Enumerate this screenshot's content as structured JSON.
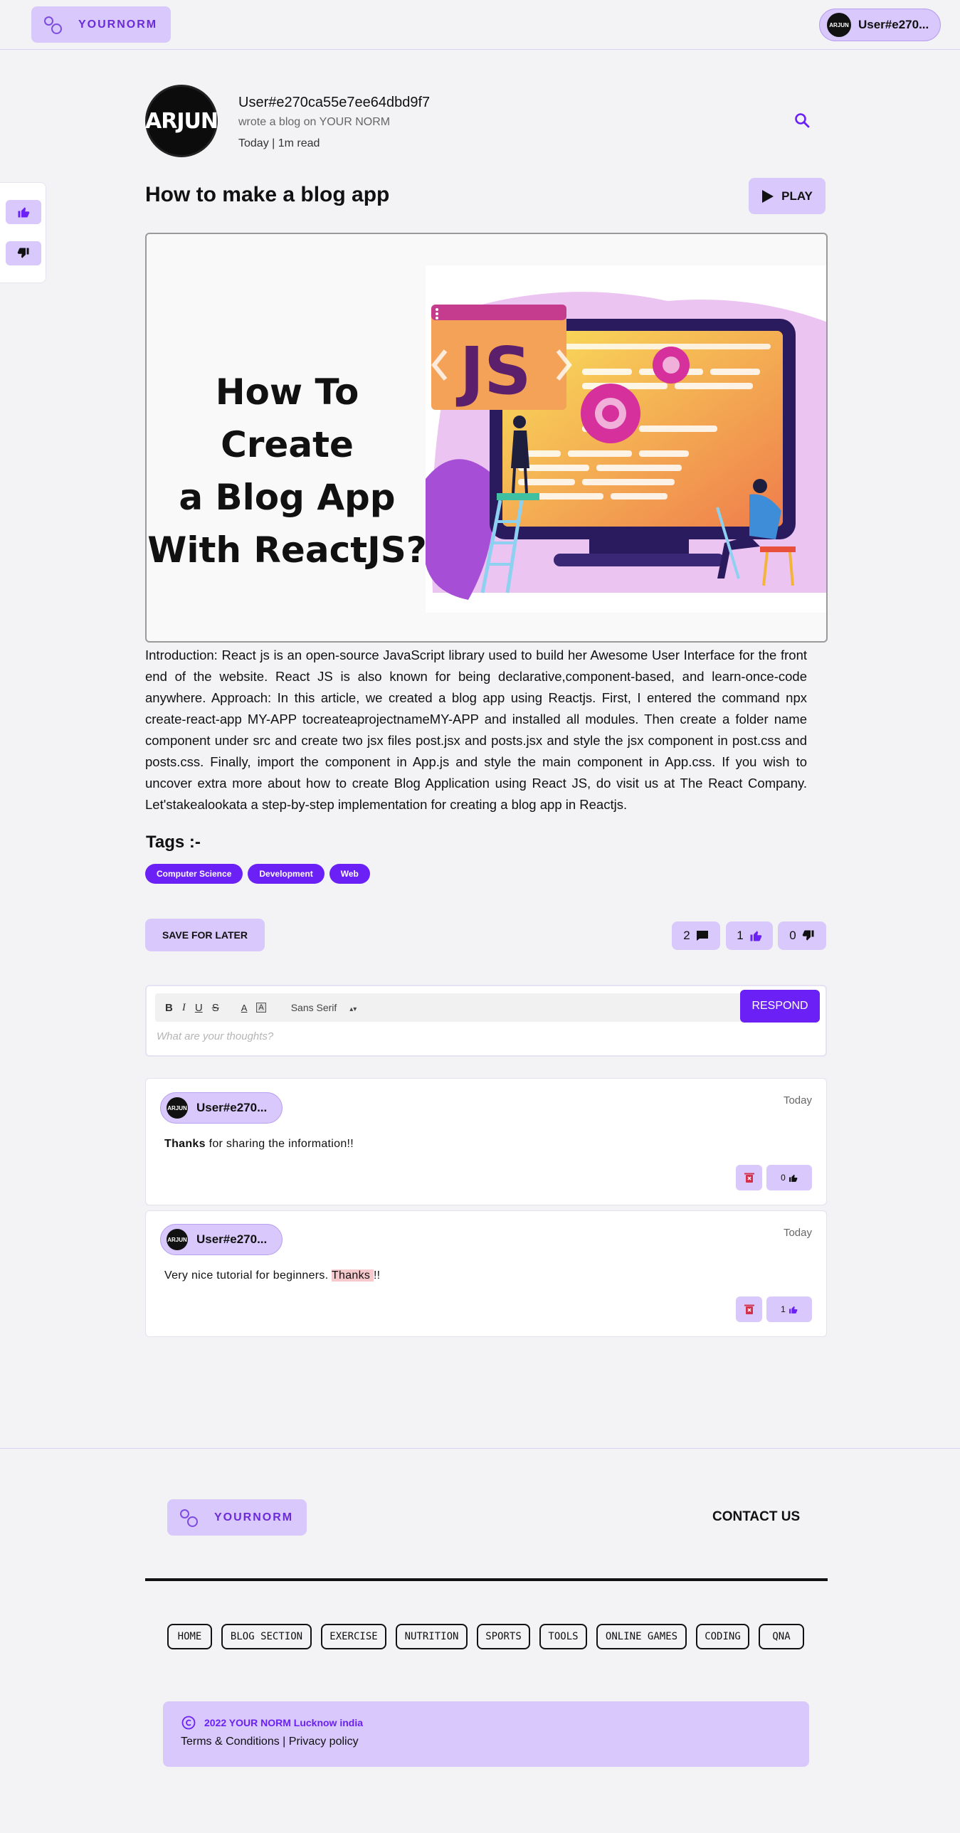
{
  "header": {
    "brand": "YOURNORM",
    "user": "User#e270...",
    "avatar_text": "ARJUN"
  },
  "author": {
    "avatar_text": "ARJUN",
    "name": "User#e270ca55e7ee64dbd9f7",
    "subtitle": "wrote a blog on YOUR NORM",
    "meta": "Today | 1m read"
  },
  "post": {
    "title": "How to make a blog app",
    "play_label": "PLAY",
    "hero": {
      "line1": "How To Create",
      "line2": "a Blog App",
      "line3": "With ReactJS?",
      "badge": "JS"
    },
    "body": "Introduction: React js is an open-source JavaScript library used to build her Awesome User Interface for the front end of the website. React JS is also known for being declarative,component-based, and learn-once-code anywhere. Approach: In this article, we created a blog app using Reactjs. First, I entered the command npx create-react-app MY-APP tocreateaprojectnameMY-APP and installed all modules. Then create a folder name component under src and create two jsx files post.jsx and posts.jsx and style the jsx component in post.css and posts.css. Finally, import the component in App.js and style the main component in App.css. If you wish to uncover extra more about how to create Blog Application using React JS, do visit us at The React Company. Let'stakealookata a step-by-step implementation for creating a blog app in Reactjs.",
    "tags_heading": "Tags :-",
    "tags": [
      "Computer Science",
      "Development",
      "Web"
    ]
  },
  "actions": {
    "save_label": "SAVE FOR LATER",
    "comments_count": "2",
    "likes_count": "1",
    "dislikes_count": "0"
  },
  "editor": {
    "bold": "B",
    "italic": "I",
    "underline": "U",
    "strike": "S",
    "color": "A",
    "background": "A",
    "font": "Sans Serif",
    "placeholder": "What are your thoughts?",
    "respond_label": "RESPOND"
  },
  "comments": [
    {
      "user": "User#e270...",
      "date": "Today",
      "bold": "Thanks",
      "text": " for sharing the information!!",
      "likes": "0"
    },
    {
      "user": "User#e270...",
      "date": "Today",
      "text_before": "Very nice tutorial for beginners. ",
      "highlight": "Thanks ",
      "text_after": "!!",
      "likes": "1"
    }
  ],
  "footer": {
    "brand": "YOURNORM",
    "contact": "CONTACT US",
    "nav": [
      "HOME",
      "BLOG SECTION",
      "EXERCISE",
      "NUTRITION",
      "SPORTS",
      "TOOLS",
      "ONLINE GAMES",
      "CODING",
      "QNA"
    ],
    "copyright": "2022 YOUR NORM Lucknow india",
    "terms": "Terms & Conditions",
    "separator": "|",
    "privacy": "Privacy policy"
  },
  "colors": {
    "accent": "#6b21f5",
    "accent_soft": "#d8c8fb",
    "background": "#f3f3f5"
  }
}
